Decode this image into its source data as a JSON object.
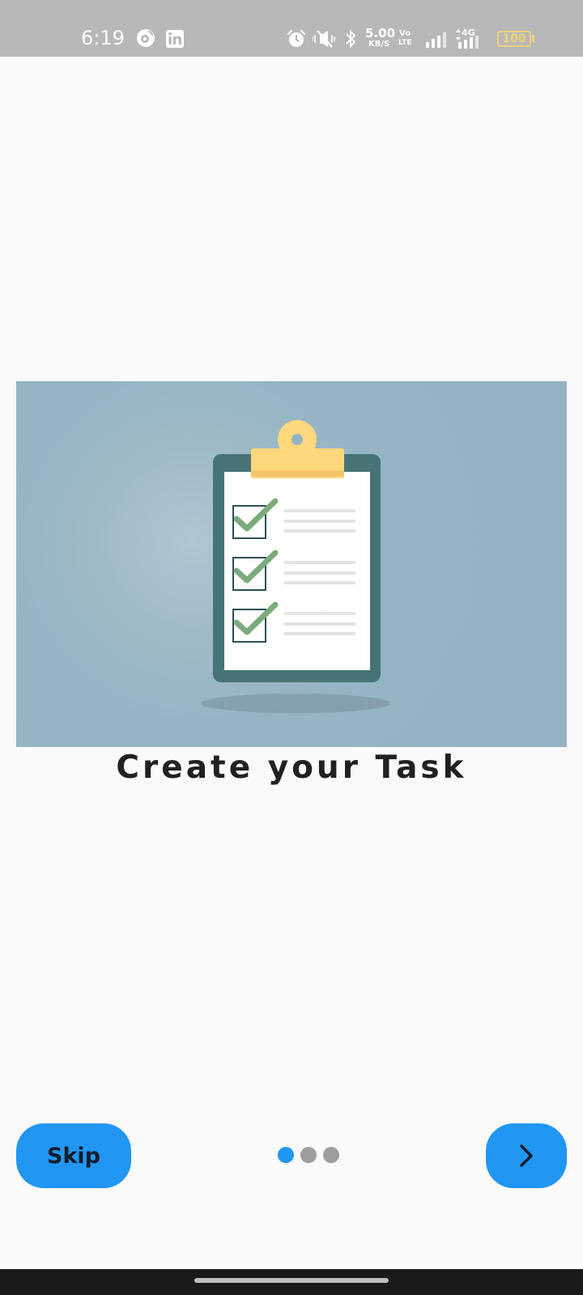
{
  "status_bar": {
    "time": "6:19",
    "net_speed_value": "5.00",
    "net_speed_unit": "KB/S",
    "volte_top": "Vo",
    "volte_bottom": "LTE",
    "network_type": "4G",
    "battery": "100",
    "icons": [
      "weibo-icon",
      "linkedin-icon",
      "alarm-icon",
      "mute-icon",
      "bluetooth-icon",
      "signal-icon",
      "signal-icon",
      "battery-icon"
    ]
  },
  "onboarding": {
    "title": "Create your Task",
    "illustration": "clipboard-checklist-illustration",
    "page_count": 3,
    "current_page": 1
  },
  "controls": {
    "skip_label": "Skip",
    "next_icon": "chevron-right-icon"
  },
  "colors": {
    "primary": "#2196f3",
    "hero_bg": "#94b4c4",
    "clipboard": "#467476",
    "clip": "#fdd87c",
    "check": "#7bab7c",
    "dot_inactive": "#9e9e9e"
  }
}
